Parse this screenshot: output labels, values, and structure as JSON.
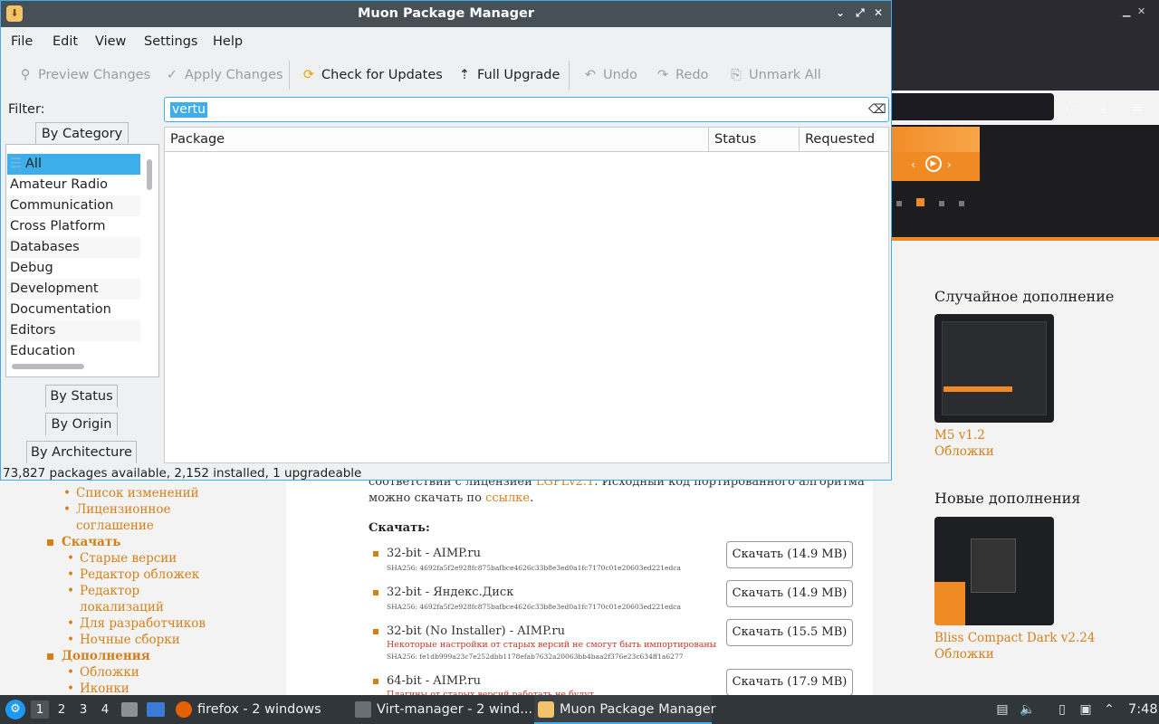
{
  "muon": {
    "title": "Muon Package Manager",
    "menu": [
      "File",
      "Edit",
      "View",
      "Settings",
      "Help"
    ],
    "toolbar": {
      "preview": "Preview Changes",
      "apply": "Apply Changes",
      "check": "Check for Updates",
      "upgrade": "Full Upgrade",
      "undo": "Undo",
      "redo": "Redo",
      "unmark": "Unmark All"
    },
    "filter_label": "Filter:",
    "filter_value": "vertu",
    "tabs": {
      "category": "By Category",
      "status": "By Status",
      "origin": "By Origin",
      "arch": "By Architecture"
    },
    "categories": [
      "All",
      "Amateur Radio",
      "Communication",
      "Cross Platform",
      "Databases",
      "Debug",
      "Development",
      "Documentation",
      "Editors",
      "Education"
    ],
    "columns": [
      "Package",
      "Status",
      "Requested"
    ],
    "statusbar": "73,827 packages available, 2,152 installed, 1 upgradeable"
  },
  "browser": {
    "sidebar": [
      {
        "text": "Список изменений",
        "level": "sub"
      },
      {
        "text": "Лицензионное",
        "level": "sub"
      },
      {
        "text": "соглашение",
        "level": "cont"
      },
      {
        "text": "Скачать",
        "level": "main"
      },
      {
        "text": "Старые версии",
        "level": "sub"
      },
      {
        "text": "Редактор обложек",
        "level": "sub"
      },
      {
        "text": "Редактор",
        "level": "sub"
      },
      {
        "text": "локализаций",
        "level": "cont"
      },
      {
        "text": "Для разработчиков",
        "level": "sub"
      },
      {
        "text": "Ночные сборки",
        "level": "sub"
      },
      {
        "text": "Дополнения",
        "level": "main"
      },
      {
        "text": "Обложки",
        "level": "sub"
      },
      {
        "text": "Иконки",
        "level": "sub"
      }
    ],
    "license_line1_pre": "соответствии с лицензией ",
    "license_link": "LGPLv2.1",
    "license_line1_post": ". Исходный код портированного алгоритма",
    "license_line2_pre": "можно скачать по ",
    "license_line2_link": "ссылке",
    "download_title": "Скачать:",
    "downloads": [
      {
        "name": "32-bit - AIMP.ru",
        "sha": "SHA256: 4692fa5f2e928fc875bafbce4626c33b8e3ed0a1fc7170c01e20603ed221edca",
        "warn": "",
        "button": "Скачать (14.9 MB)"
      },
      {
        "name": "32-bit - Яндекс.Диск",
        "sha": "SHA256: 4692fa5f2e928fc875bafbce4626c33b8e3ed0a1fc7170c01e20603ed221edca",
        "warn": "",
        "button": "Скачать (14.9 MB)"
      },
      {
        "name": "32-bit (No Installer) - AIMP.ru",
        "sha": "SHA256: fe1db999a23c7e252dbb1178efab7632a20063bb4baa2f376e23c634ff1a6277",
        "warn": "Некоторые настройки от старых версий не смогут быть импортированы",
        "button": "Скачать (15.5 MB)"
      },
      {
        "name": "64-bit - AIMP.ru",
        "sha": "",
        "warn": "Плагины от старых версий работать не будут",
        "button": "Скачать (17.9 MB)"
      }
    ],
    "random_title": "Случайное дополнение",
    "random_name": "M5 v1.2",
    "random_cat": "Обложки",
    "new_title": "Новые дополнения",
    "new_name": "Bliss Compact Dark v2.24",
    "new_cat": "Обложки"
  },
  "taskbar": {
    "desktops": [
      "1",
      "2",
      "3",
      "4"
    ],
    "items": [
      {
        "label": "firefox - 2 windows",
        "color": "#e66000"
      },
      {
        "label": "Virt-manager - 2 wind...",
        "color": "#6a6f75"
      },
      {
        "label": "Muon Package Manager",
        "color": "#f3c36b"
      }
    ],
    "clock": "7:48"
  }
}
